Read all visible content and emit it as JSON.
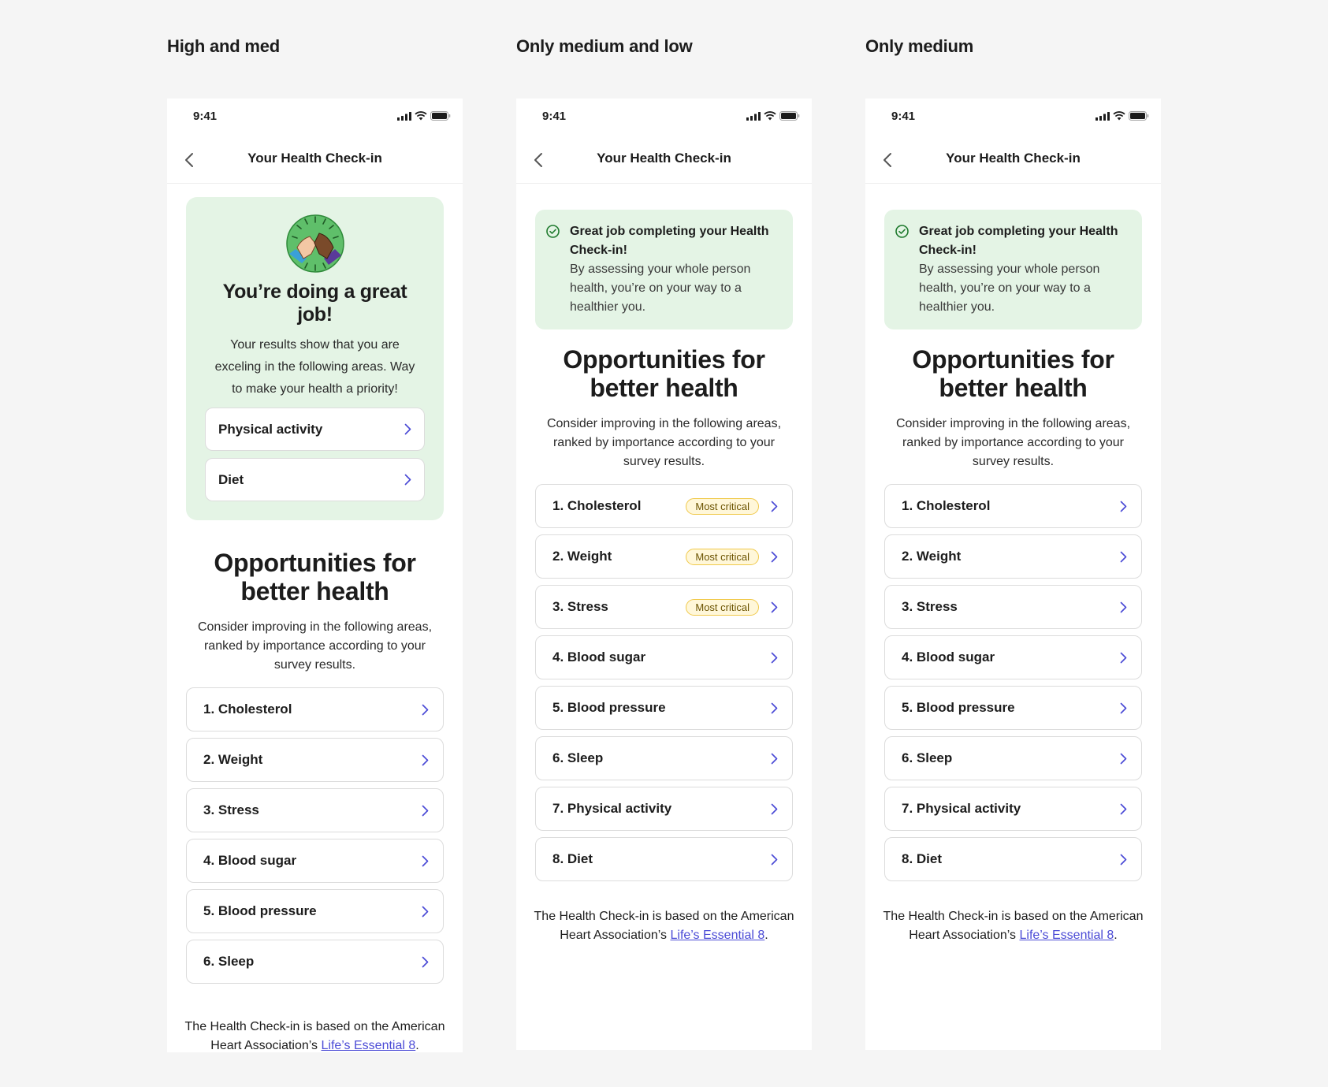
{
  "variants": [
    {
      "title": "High and med"
    },
    {
      "title": "Only medium and low"
    },
    {
      "title": "Only medium"
    }
  ],
  "status": {
    "time": "9:41"
  },
  "nav": {
    "title": "Your Health Check-in"
  },
  "great_job": {
    "title": "You’re doing a great job!",
    "body": "Your results show that you are exceling in the following areas. Way to make your health a priority!",
    "items": [
      "Physical activity",
      "Diet"
    ]
  },
  "done_banner": {
    "title": "Great job completing your Health Check-in!",
    "body": "By assessing your whole person health, you’re on your way to a healthier you."
  },
  "opportunities": {
    "title": "Opportunities for better health",
    "subtitle": "Consider improving in the following areas, ranked by importance according to your survey results.",
    "badge": "Most critical",
    "items_short": [
      "1. Cholesterol",
      "2. Weight",
      "3. Stress",
      "4. Blood sugar",
      "5. Blood pressure",
      "6. Sleep"
    ],
    "items_full": [
      "1. Cholesterol",
      "2. Weight",
      "3. Stress",
      "4. Blood sugar",
      "5. Blood pressure",
      "6. Sleep",
      "7. Physical activity",
      "8. Diet"
    ]
  },
  "footer": {
    "text": "The Health Check-in is based on the American Heart Association’s ",
    "link": "Life’s Essential 8",
    "end": "."
  },
  "icons": {
    "back": "chevron-left-icon",
    "item_arrow": "chevron-right-icon",
    "check": "check-circle-icon",
    "signal": "signal-icon",
    "wifi": "wifi-icon",
    "battery": "battery-icon",
    "illustration": "high-five-illustration"
  },
  "colors": {
    "card_green": "#e4f4e5",
    "link_blue": "#4b4bd6",
    "badge_yellow": "#f0c94a",
    "check_green": "#1f7a2e"
  }
}
